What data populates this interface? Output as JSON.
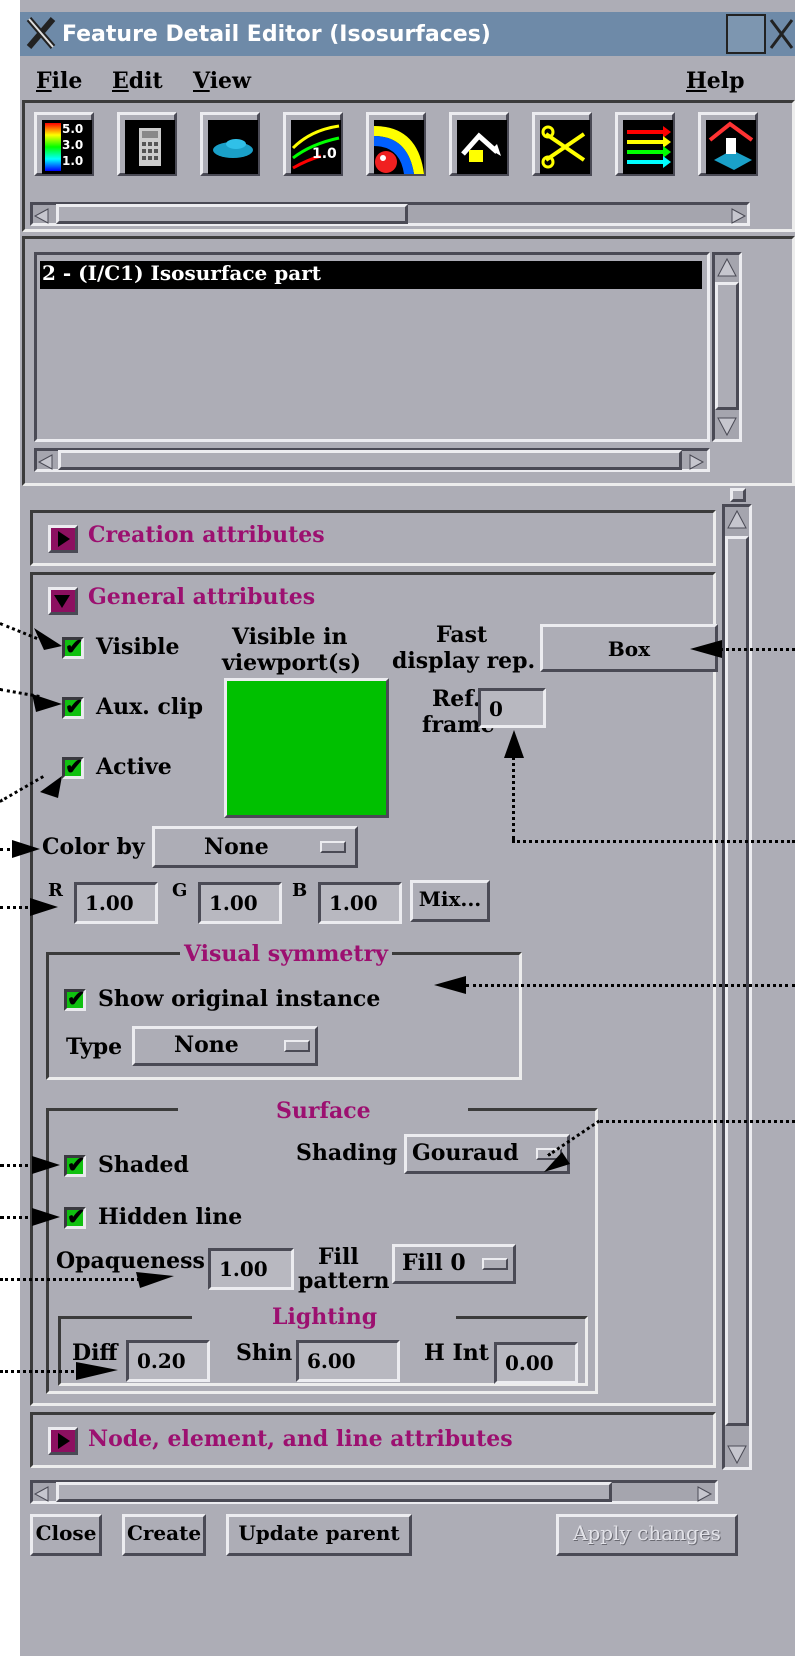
{
  "window": {
    "title": "Feature Detail Editor (Isosurfaces)"
  },
  "menubar": {
    "file": "File",
    "edit": "Edit",
    "view": "View",
    "help": "Help"
  },
  "toolbar": {
    "icons": [
      "color-legend-icon",
      "calculator-icon",
      "part-object-icon",
      "contour-icon",
      "isosurface-icon",
      "arrow-icon",
      "clip-icon",
      "vector-arrows-icon",
      "elevated-surface-icon"
    ],
    "legend_values": [
      "5.0",
      "3.0",
      "1.0"
    ],
    "contour_label": "1.0"
  },
  "part_list": {
    "items": [
      "2 - (I/C1) Isosurface part"
    ]
  },
  "sections": {
    "creation": "Creation attributes",
    "general": "General attributes",
    "node_element": "Node, element, and line attributes"
  },
  "general": {
    "visible": "Visible",
    "aux_clip": "Aux. clip",
    "active": "Active",
    "visible_viewports_1": "Visible in",
    "visible_viewports_2": "viewport(s)",
    "fast_display_1": "Fast",
    "fast_display_2": "display rep.",
    "fast_display_value": "Box",
    "ref_frame_1": "Ref.",
    "ref_frame_2": "frame",
    "ref_frame_value": "0",
    "color_by_label": "Color by",
    "color_by_value": "None",
    "r_label": "R",
    "r_value": "1.00",
    "g_label": "G",
    "g_value": "1.00",
    "b_label": "B",
    "b_value": "1.00",
    "mix_button": "Mix...",
    "viewport_color": "#00c000"
  },
  "visual_symmetry": {
    "title": "Visual symmetry",
    "show_original": "Show original instance",
    "type_label": "Type",
    "type_value": "None"
  },
  "surface": {
    "title": "Surface",
    "shaded": "Shaded",
    "hidden_line": "Hidden line",
    "shading_label": "Shading",
    "shading_value": "Gouraud",
    "opaqueness_label": "Opaqueness",
    "opaqueness_value": "1.00",
    "fill_1": "Fill",
    "fill_2": "pattern",
    "fill_value": "Fill 0"
  },
  "lighting": {
    "title": "Lighting",
    "diff_label": "Diff",
    "diff_value": "0.20",
    "shin_label": "Shin",
    "shin_value": "6.00",
    "hint_label": "H Int",
    "hint_value": "0.00"
  },
  "footer": {
    "close": "Close",
    "create": "Create",
    "update_parent": "Update parent",
    "apply": "Apply changes"
  },
  "colors": {
    "title_bar": "#6e8aa8",
    "panel": "#adadb6",
    "section_title": "#9c1070",
    "check": "#10c010"
  }
}
